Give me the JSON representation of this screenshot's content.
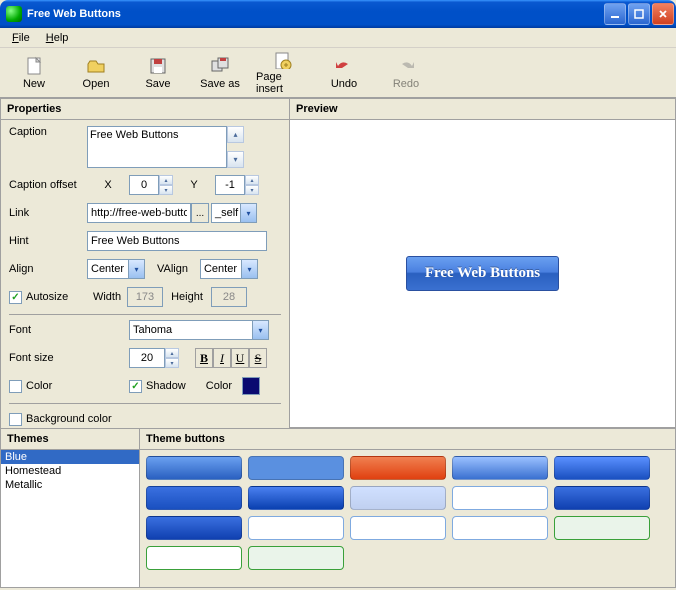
{
  "window": {
    "title": "Free Web Buttons"
  },
  "menu": {
    "file": "File",
    "help": "Help"
  },
  "toolbar": {
    "new": "New",
    "open": "Open",
    "save": "Save",
    "saveas": "Save as",
    "pageinsert": "Page insert",
    "undo": "Undo",
    "redo": "Redo"
  },
  "panels": {
    "properties": "Properties",
    "preview": "Preview",
    "themes": "Themes",
    "theme_buttons": "Theme buttons"
  },
  "properties": {
    "labels": {
      "caption": "Caption",
      "caption_offset": "Caption offset",
      "x": "X",
      "y": "Y",
      "link": "Link",
      "hint": "Hint",
      "align": "Align",
      "valign": "VAlign",
      "autosize": "Autosize",
      "width": "Width",
      "height": "Height",
      "font": "Font",
      "font_size": "Font size",
      "color": "Color",
      "shadow": "Shadow",
      "shadow_color": "Color",
      "bg_color": "Background color"
    },
    "values": {
      "caption": "Free Web Buttons",
      "offset_x": "0",
      "offset_y": "-1",
      "link": "http://free-web-buttons",
      "target": "_self",
      "hint": "Free Web Buttons",
      "align": "Center",
      "valign": "Center",
      "autosize": true,
      "width": "173",
      "height": "28",
      "font": "Tahoma",
      "font_size": "20",
      "text_color": "#ffffff",
      "shadow": true,
      "shadow_color": "#0a0a70",
      "bg_color": "#ffffff"
    }
  },
  "preview": {
    "button_text": "Free Web Buttons"
  },
  "themes": {
    "items": [
      "Blue",
      "Homestead",
      "Metallic"
    ],
    "selected": 0
  },
  "theme_buttons": [
    {
      "bg": "linear-gradient(#6aa0f0,#2a60c0)"
    },
    {
      "bg": "linear-gradient(#5a90e0,#5a90e0)"
    },
    {
      "bg": "linear-gradient(#f08050,#e04010)"
    },
    {
      "bg": "linear-gradient(#9ac0ff,#3a70d0)"
    },
    {
      "bg": "linear-gradient(#5a90ff,#1a50c0)"
    },
    {
      "bg": "linear-gradient(#3a70e0,#1a50c0)"
    },
    {
      "bg": "linear-gradient(#4a80f0,#0a40b0)"
    },
    {
      "bg": "linear-gradient(#d0e0ff,#c0d0f0)"
    },
    {
      "bg": "#ffffff",
      "border": "#7faae0"
    },
    {
      "bg": "linear-gradient(#3a70e0,#1040b0)"
    },
    {
      "bg": "linear-gradient(#3a70e0,#1040b0)"
    },
    {
      "bg": "#ffffff",
      "border": "#7faae0"
    },
    {
      "bg": "#ffffff",
      "border": "#7faae0"
    },
    {
      "bg": "#ffffff",
      "border": "#7faae0"
    },
    {
      "bg": "#eaf4ea",
      "border": "#3aa03a"
    },
    {
      "bg": "#ffffff",
      "border": "#3aa03a"
    },
    {
      "bg": "#eaf4ea",
      "border": "#3aa03a"
    }
  ]
}
